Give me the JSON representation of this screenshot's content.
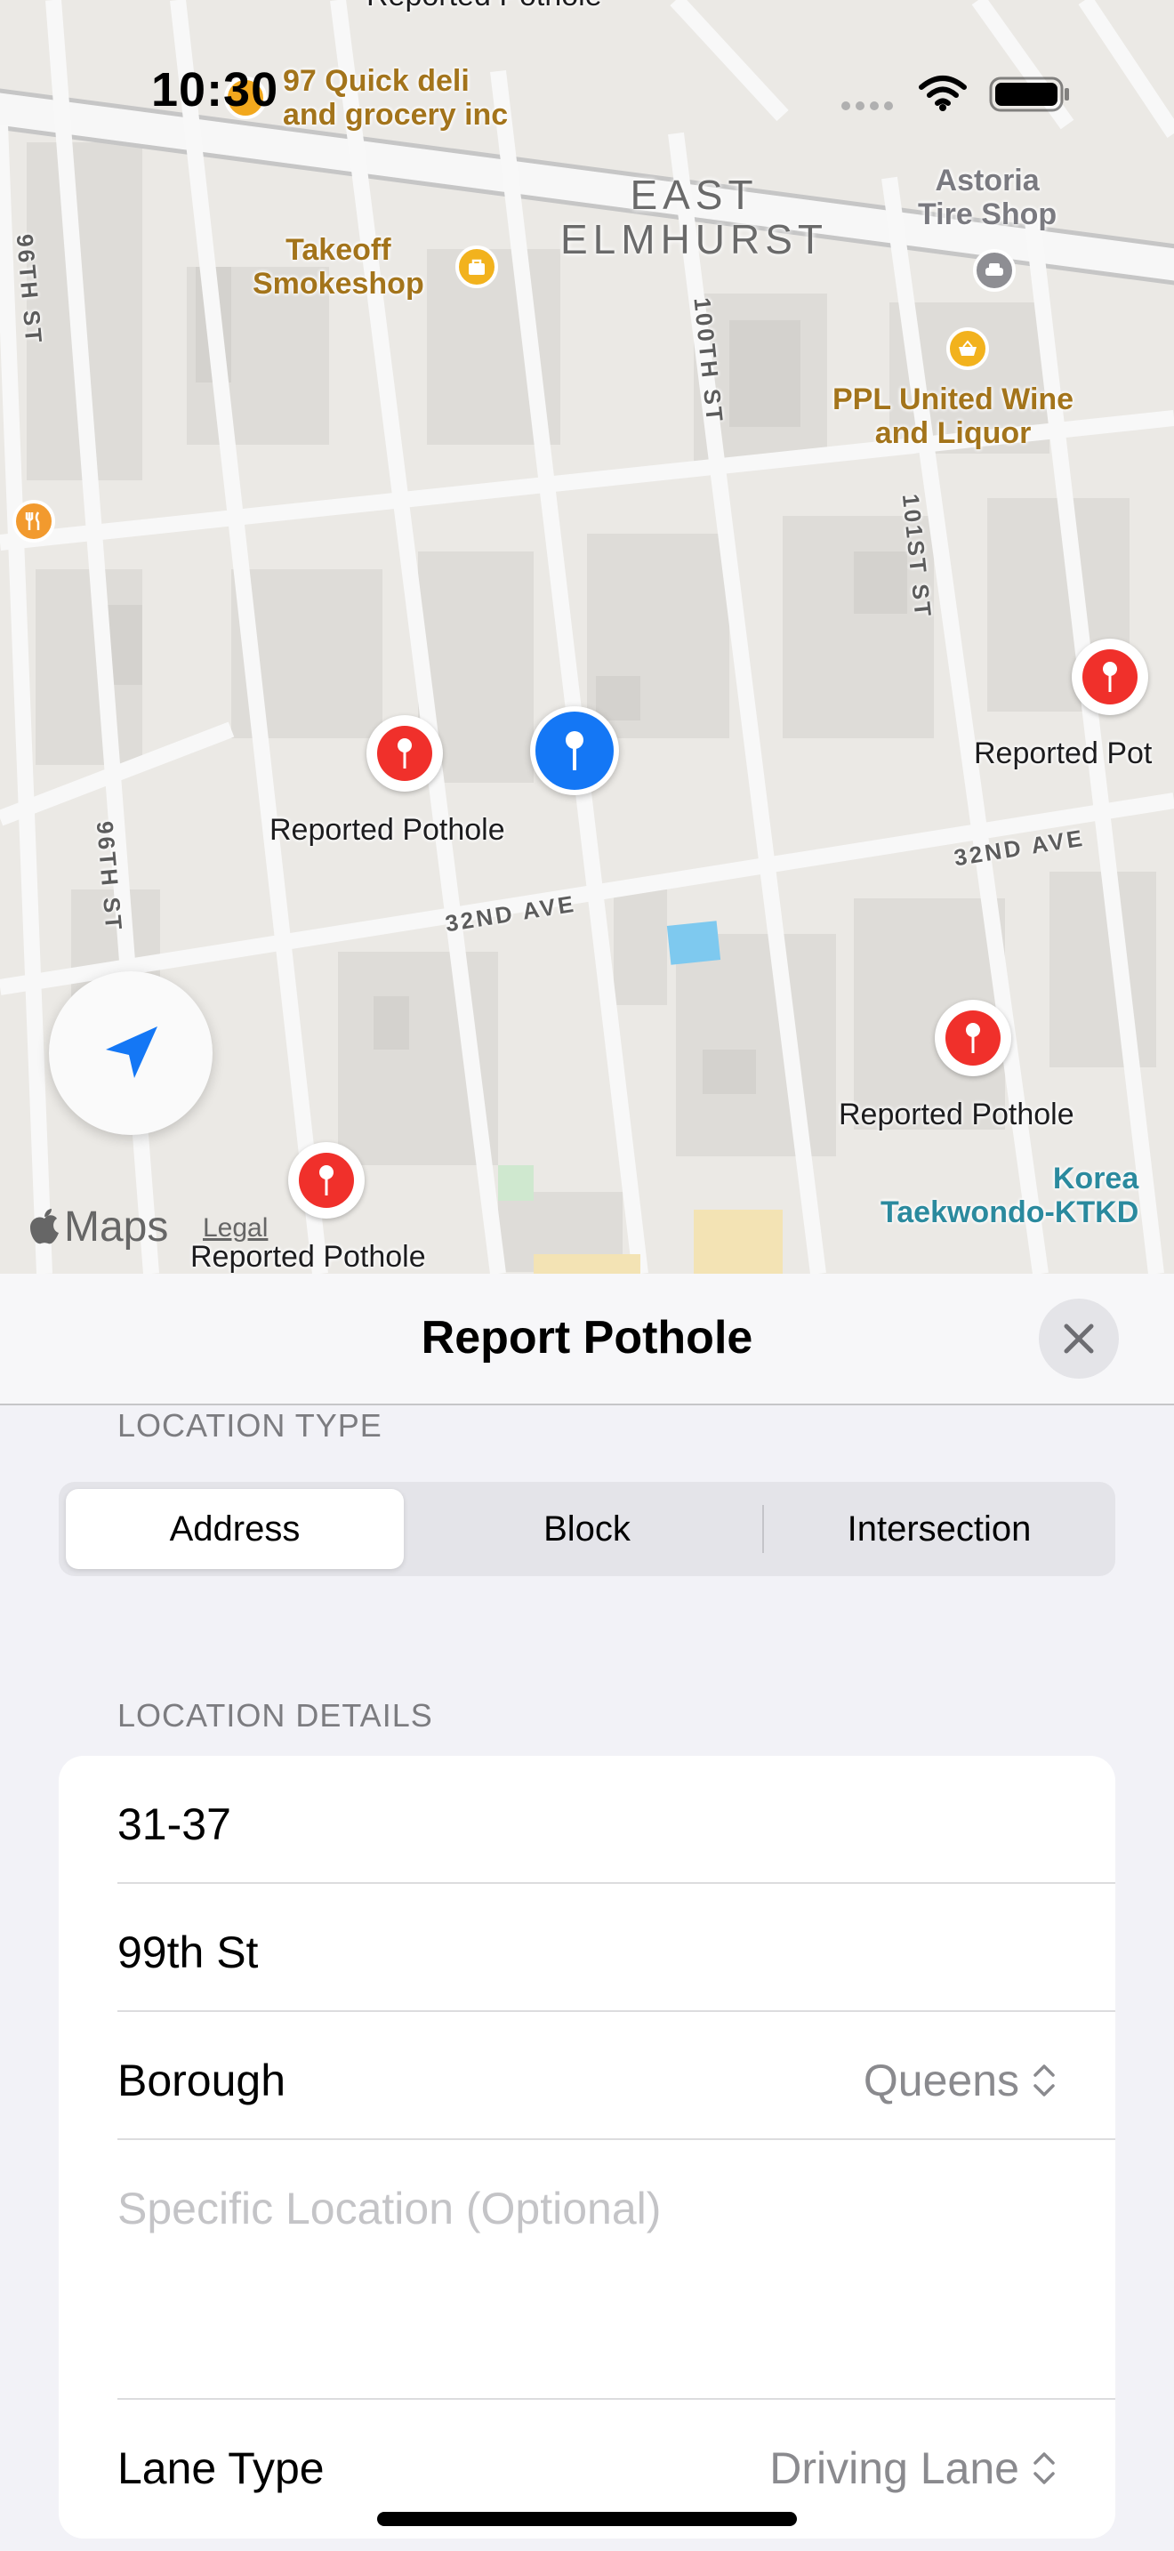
{
  "status_bar": {
    "time": "10:30"
  },
  "map": {
    "neighborhood": [
      "EAST",
      "ELMHURST"
    ],
    "streets": {
      "s96th_a": "96TH ST",
      "s96th_b": "96TH ST",
      "s100th": "100TH ST",
      "s101st": "101ST ST",
      "ave32_a": "32ND AVE",
      "ave32_b": "32ND AVE"
    },
    "pois": {
      "quick_deli": [
        "97 Quick deli",
        "and grocery inc"
      ],
      "takeoff": [
        "Takeoff",
        "Smokeshop"
      ],
      "astoria": [
        "Astoria",
        "Tire Shop"
      ],
      "ppl": [
        "PPL United Wine",
        "and Liquor"
      ],
      "korea": [
        "Korea",
        "Taekwondo-KTKD"
      ]
    },
    "pins": {
      "top_label": "Reported Pothole",
      "pin1": "Reported Pothole",
      "pin2": "Reported Pot",
      "pin3": "Reported Pothole",
      "pin4": "Reported Pothole"
    },
    "brand": "Maps",
    "legal": "Legal"
  },
  "sheet": {
    "title": "Report Pothole",
    "location_type_header": "LOCATION TYPE",
    "segments": [
      "Address",
      "Block",
      "Intersection"
    ],
    "selected_segment": "Address",
    "location_details_header": "LOCATION DETAILS",
    "house_number": "31-37",
    "street": "99th St",
    "borough_label": "Borough",
    "borough_value": "Queens",
    "specific_location_placeholder": "Specific Location (Optional)",
    "lane_type_label": "Lane Type",
    "lane_type_value": "Driving Lane"
  },
  "colors": {
    "accent": "#1477f5",
    "pin_red": "#f0302b",
    "poi_gold": "#a3741b"
  },
  "icons": [
    "location-arrow-icon",
    "close-icon",
    "chevron-updown-icon",
    "pin-icon",
    "apple-logo-icon",
    "wifi-icon",
    "battery-icon"
  ]
}
